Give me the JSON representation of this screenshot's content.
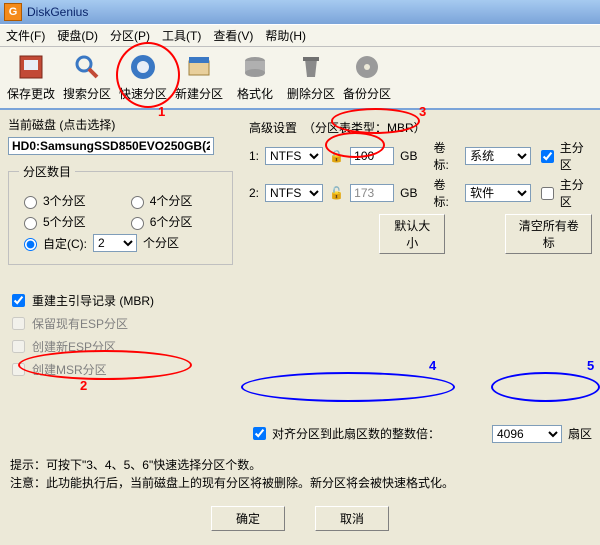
{
  "title": "DiskGenius",
  "menu": [
    "文件(F)",
    "硬盘(D)",
    "分区(P)",
    "工具(T)",
    "查看(V)",
    "帮助(H)"
  ],
  "toolbar": [
    {
      "name": "save",
      "label": "保存更改"
    },
    {
      "name": "search",
      "label": "搜索分区"
    },
    {
      "name": "quick",
      "label": "快速分区"
    },
    {
      "name": "new",
      "label": "新建分区"
    },
    {
      "name": "format",
      "label": "格式化"
    },
    {
      "name": "delete",
      "label": "删除分区"
    },
    {
      "name": "backup",
      "label": "备份分区"
    }
  ],
  "left": {
    "current_disk_label": "当前磁盘 (点击选择)",
    "disk_text": "HD0:SamsungSSD850EVO250GB(2",
    "count_legend": "分区数目",
    "r1": "3个分区",
    "r2": "4个分区",
    "r3": "5个分区",
    "r4": "6个分区",
    "r5": "自定(C):",
    "custom_val": "2",
    "custom_suf": "个分区",
    "c1": "重建主引导记录 (MBR)",
    "c2": "保留现有ESP分区",
    "c3": "创建新ESP分区",
    "c4": "创建MSR分区"
  },
  "right": {
    "adv_label": "高级设置",
    "mbr": "（分区表类型：MBR）",
    "row1": {
      "idx": "1:",
      "fs": "NTFS",
      "size": "100",
      "unit": "GB",
      "vl": "卷标:",
      "vv": "系统",
      "chk": "主分区"
    },
    "row2": {
      "idx": "2:",
      "fs": "NTFS",
      "size": "173",
      "unit": "GB",
      "vl": "卷标:",
      "vv": "软件",
      "chk": "主分区"
    },
    "default_btn": "默认大小",
    "clear_btn": "清空所有卷标",
    "align_chk": "对齐分区到此扇区数的整数倍：",
    "sector_val": "4096",
    "sector_suf": "扇区"
  },
  "tips": {
    "t1": "提示：可按下\"3、4、5、6\"快速选择分区个数。",
    "t2": "注意：此功能执行后，当前磁盘上的现有分区将被删除。新分区将会被快速格式化。"
  },
  "buttons": {
    "ok": "确定",
    "cancel": "取消"
  },
  "annot": {
    "n1": "1",
    "n2": "2",
    "n3": "3",
    "n4": "4",
    "n5": "5"
  }
}
